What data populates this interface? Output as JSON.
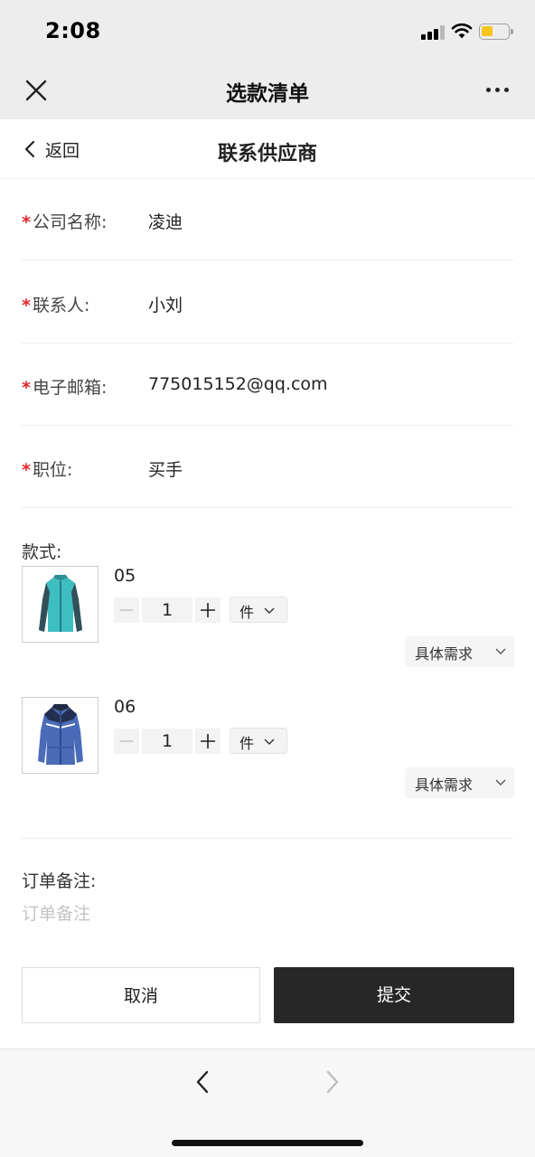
{
  "status_bar": {
    "time": "2:08"
  },
  "wechat_header": {
    "title": "选款清单"
  },
  "page_nav": {
    "back_label": "返回",
    "title": "联系供应商"
  },
  "form": {
    "required_mark": "*",
    "fields": [
      {
        "label": "公司名称:",
        "value": "凌迪"
      },
      {
        "label": "联系人:",
        "value": "小刘"
      },
      {
        "label": "电子邮箱:",
        "value": "775015152@qq.com"
      },
      {
        "label": "职位:",
        "value": "买手"
      }
    ]
  },
  "styles_section": {
    "label": "款式:",
    "products": [
      {
        "name": "05",
        "quantity": "1",
        "unit": "件",
        "requirement_label": "具体需求",
        "image_icon": "teal-jacket-icon"
      },
      {
        "name": "06",
        "quantity": "1",
        "unit": "件",
        "requirement_label": "具体需求",
        "image_icon": "blue-parka-icon"
      }
    ]
  },
  "order_note": {
    "label": "订单备注:",
    "placeholder": "订单备注"
  },
  "actions": {
    "cancel_label": "取消",
    "submit_label": "提交"
  },
  "colors": {
    "required": "#e0252b",
    "submit_bg": "#272727",
    "battery": "#f5c518"
  }
}
